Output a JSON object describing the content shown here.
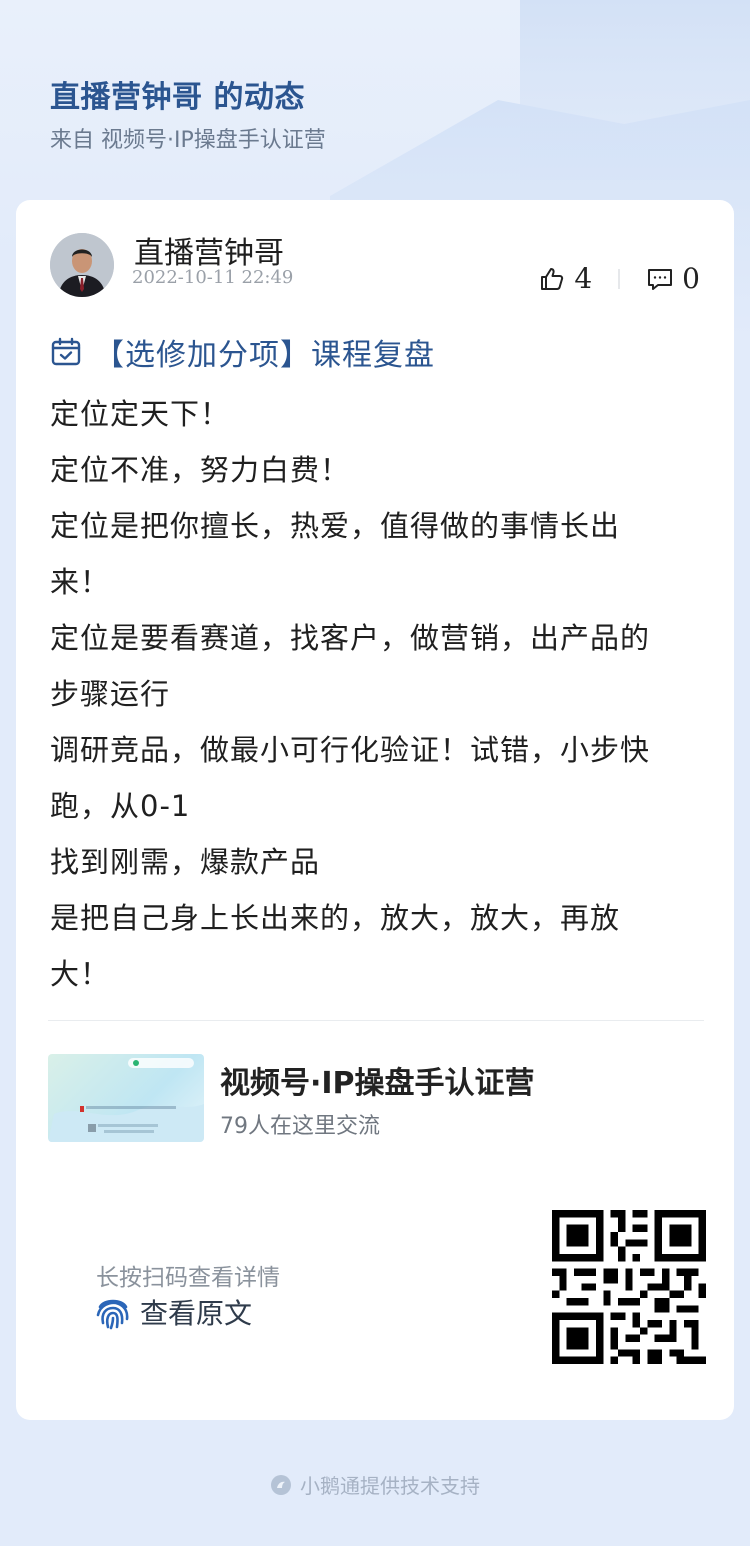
{
  "header": {
    "title": "直播营钟哥 的动态",
    "source": "来自 视频号·IP操盘手认证营"
  },
  "post": {
    "author": "直播营钟哥",
    "date": "2022-10-11 22:49",
    "likes": "4",
    "comments": "0",
    "course_title": "【选修加分项】课程复盘",
    "lines": [
      "定位定天下！",
      "定位不准，努力白费！",
      "定位是把你擅长，热爱，值得做的事情长出",
      "来！",
      "定位是要看赛道，找客户，做营销，出产品的",
      "步骤运行",
      "调研竞品，做最小可行化验证！试错，小步快",
      "跑，从0-1",
      "找到刚需，爆款产品",
      "是把自己身上长出来的，放大，放大，再放",
      "大！"
    ]
  },
  "group": {
    "name": "视频号·IP操盘手认证营",
    "member_count": "79人在这里交流",
    "thumb_text": "IP操盘手认证营"
  },
  "qr_section": {
    "hint": "长按扫码查看详情",
    "view_label": "查看原文"
  },
  "footer": {
    "text": "小鹅通提供技术支持"
  },
  "colors": {
    "accent": "#2b5590",
    "background": "#e2ebfa"
  }
}
